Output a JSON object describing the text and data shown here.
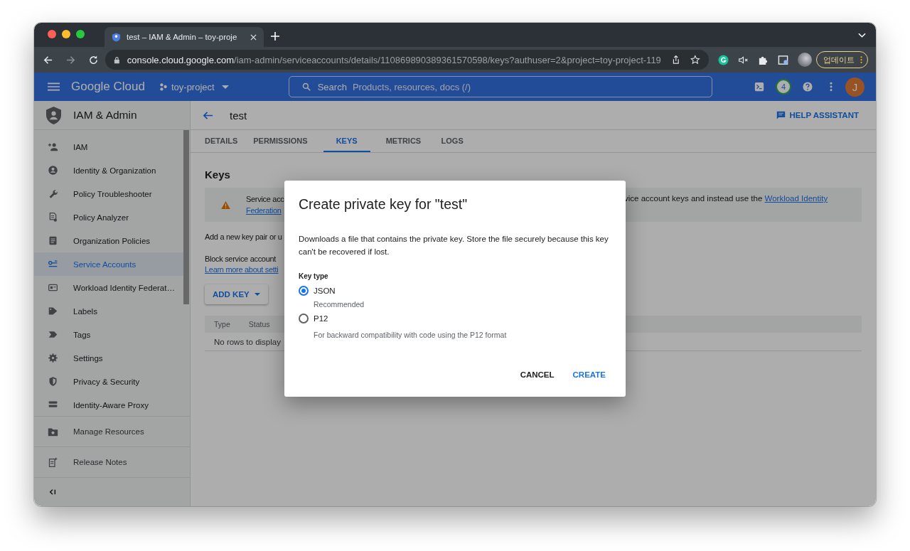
{
  "browser": {
    "tab_title": "test – IAM & Admin – toy-proje",
    "url_host": "console.cloud.google.com",
    "url_path": "/iam-admin/serviceaccounts/details/110869890389361570598/keys?authuser=2&project=toy-project-119",
    "update_button": "업데이트"
  },
  "header": {
    "logo": "Google Cloud",
    "project": "toy-project",
    "search_label": "Search",
    "search_placeholder": "Products, resources, docs (/)",
    "notification_count": "4",
    "avatar": "J"
  },
  "sidebar": {
    "title": "IAM & Admin",
    "items": [
      {
        "label": "IAM",
        "selected": false
      },
      {
        "label": "Identity & Organization",
        "selected": false
      },
      {
        "label": "Policy Troubleshooter",
        "selected": false
      },
      {
        "label": "Policy Analyzer",
        "selected": false
      },
      {
        "label": "Organization Policies",
        "selected": false
      },
      {
        "label": "Service Accounts",
        "selected": true
      },
      {
        "label": "Workload Identity Federat…",
        "selected": false
      },
      {
        "label": "Labels",
        "selected": false
      },
      {
        "label": "Tags",
        "selected": false
      },
      {
        "label": "Settings",
        "selected": false
      },
      {
        "label": "Privacy & Security",
        "selected": false
      },
      {
        "label": "Identity-Aware Proxy",
        "selected": false
      }
    ],
    "footer": [
      "Manage Resources",
      "Release Notes"
    ]
  },
  "page": {
    "title": "test",
    "help": "HELP ASSISTANT",
    "tabs": [
      {
        "label": "DETAILS",
        "selected": false
      },
      {
        "label": "PERMISSIONS",
        "selected": false
      },
      {
        "label": "KEYS",
        "selected": true
      },
      {
        "label": "METRICS",
        "selected": false
      },
      {
        "label": "LOGS",
        "selected": false
      }
    ],
    "section_title": "Keys",
    "banner": {
      "left_text": "Service acc",
      "left_link": "Federation",
      "right_text": "vice account keys and instead use the",
      "right_link": "Workload Identity"
    },
    "add_text": "Add a new key pair or u",
    "block_text": "Block service account",
    "learn_link": "Learn more about setti",
    "add_key": "ADD KEY",
    "table": {
      "columns": [
        "Type",
        "Status"
      ],
      "empty": "No rows to display"
    }
  },
  "dialog": {
    "title": "Create private key for \"test\"",
    "description": "Downloads a file that contains the private key. Store the file securely because this key can't be recovered if lost.",
    "key_type_label": "Key type",
    "options": [
      {
        "label": "JSON",
        "hint": "Recommended",
        "selected": true
      },
      {
        "label": "P12",
        "hint": "For backward compatibility with code using the P12 format",
        "selected": false
      }
    ],
    "buttons": [
      {
        "label": "CANCEL",
        "kind": "plain"
      },
      {
        "label": "CREATE",
        "kind": "primary"
      }
    ]
  }
}
